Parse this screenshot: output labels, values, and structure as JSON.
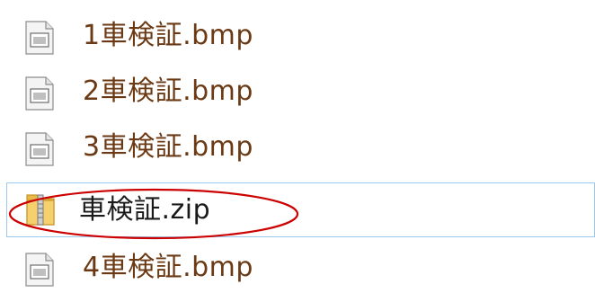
{
  "files": [
    {
      "name": "1車検証.bmp",
      "type": "bmp",
      "icon": "bitmap-image-file-icon",
      "selected": false
    },
    {
      "name": "2車検証.bmp",
      "type": "bmp",
      "icon": "bitmap-image-file-icon",
      "selected": false
    },
    {
      "name": "3車検証.bmp",
      "type": "bmp",
      "icon": "bitmap-image-file-icon",
      "selected": false
    },
    {
      "name": "車検証.zip",
      "type": "zip",
      "icon": "zip-folder-icon",
      "selected": true
    },
    {
      "name": "4車検証.bmp",
      "type": "bmp",
      "icon": "bitmap-image-file-icon",
      "selected": false
    }
  ],
  "colors": {
    "bmp_text": "#6b3a14",
    "selected_text": "#1a1a1a",
    "selection_border": "#99c9ef",
    "annotation": "#cc0000",
    "zip_folder": "#f0c85a"
  }
}
